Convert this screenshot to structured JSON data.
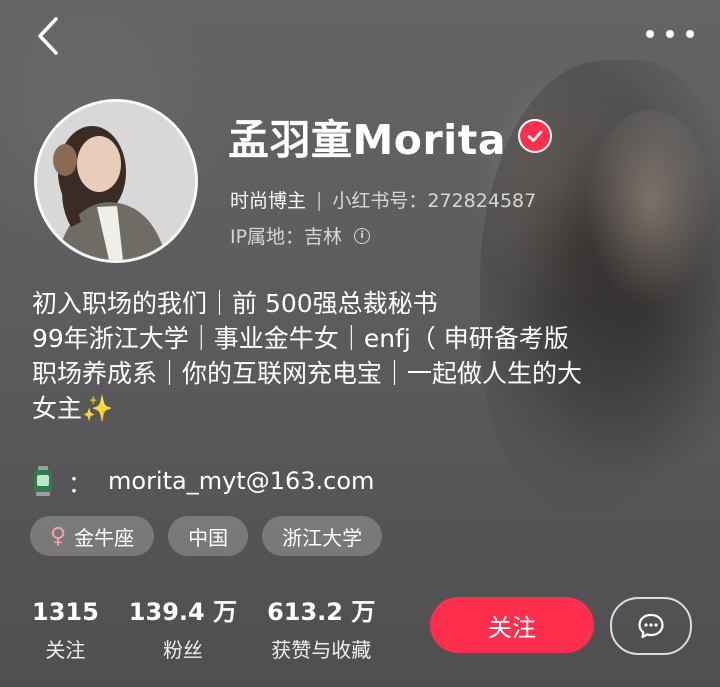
{
  "header": {
    "back_icon": "chevron-left-icon",
    "more_icon": "more-dots-icon"
  },
  "profile": {
    "name": "孟羽童Morita",
    "verified_icon": "verified-check-icon",
    "category": "时尚博主",
    "redbook_id": "小红书号：272824587",
    "ip_location": "IP属地：吉林",
    "info_icon": "info-icon"
  },
  "bio": {
    "lines": [
      "初入职场的我们｜前 500强总裁秘书",
      "99年浙江大学｜事业金牛女｜enfj（ 申研备考版",
      "职场养成系｜你的互联网充电宝｜一起做人生的大",
      "女主✨"
    ],
    "email_colon": "：",
    "email": "morita_myt@163.com"
  },
  "tags": [
    {
      "icon": "female-icon",
      "symbol": "♀",
      "label": "金牛座"
    },
    {
      "label": "中国"
    },
    {
      "label": "浙江大学"
    }
  ],
  "stats": [
    {
      "value": "1315",
      "label": "关注"
    },
    {
      "value": "139.4 万",
      "label": "粉丝"
    },
    {
      "value": "613.2 万",
      "label": "获赞与收藏"
    }
  ],
  "actions": {
    "follow_label": "关注",
    "chat_icon": "chat-bubble-icon"
  },
  "colors": {
    "accent": "#ff2e4d",
    "background": "#5e5e60"
  }
}
